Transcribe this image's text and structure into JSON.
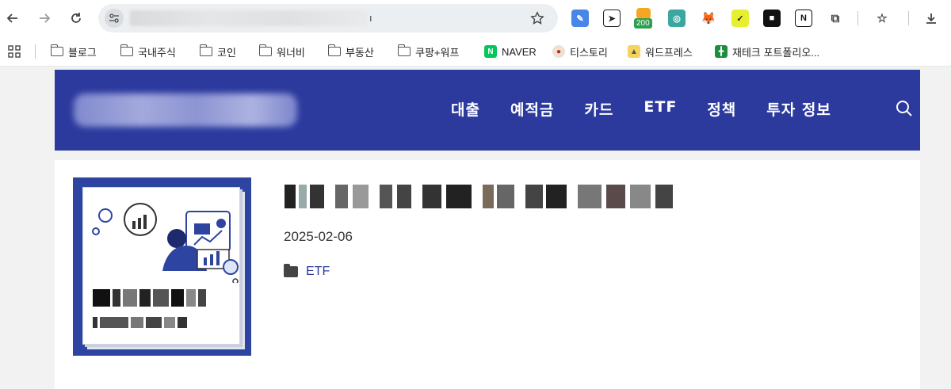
{
  "browser": {
    "url_suffix": "ı",
    "toolbar_icons": [
      "back-icon",
      "forward-icon",
      "reload-icon",
      "site-settings-icon",
      "bookmark-star-icon"
    ],
    "extension_badge": "200"
  },
  "bookmarks": [
    {
      "label": "블로그",
      "icon": "folder-icon"
    },
    {
      "label": "국내주식",
      "icon": "folder-icon"
    },
    {
      "label": "코인",
      "icon": "folder-icon"
    },
    {
      "label": "워너비",
      "icon": "folder-icon"
    },
    {
      "label": "부동산",
      "icon": "folder-icon"
    },
    {
      "label": "쿠팡+워프",
      "icon": "folder-icon"
    },
    {
      "label": "NAVER",
      "icon": "naver-icon"
    },
    {
      "label": "티스토리",
      "icon": "tistory-icon"
    },
    {
      "label": "워드프레스",
      "icon": "wordpress-icon"
    },
    {
      "label": "재테크 포트폴리오...",
      "icon": "sheets-icon"
    }
  ],
  "site": {
    "nav": [
      "대출",
      "예적금",
      "카드",
      "ETF",
      "정책",
      "투자 정보"
    ],
    "header_color": "#2c3a9e"
  },
  "post": {
    "date": "2025-02-06",
    "category": "ETF",
    "thumbnail_color": "#2d45a0"
  }
}
